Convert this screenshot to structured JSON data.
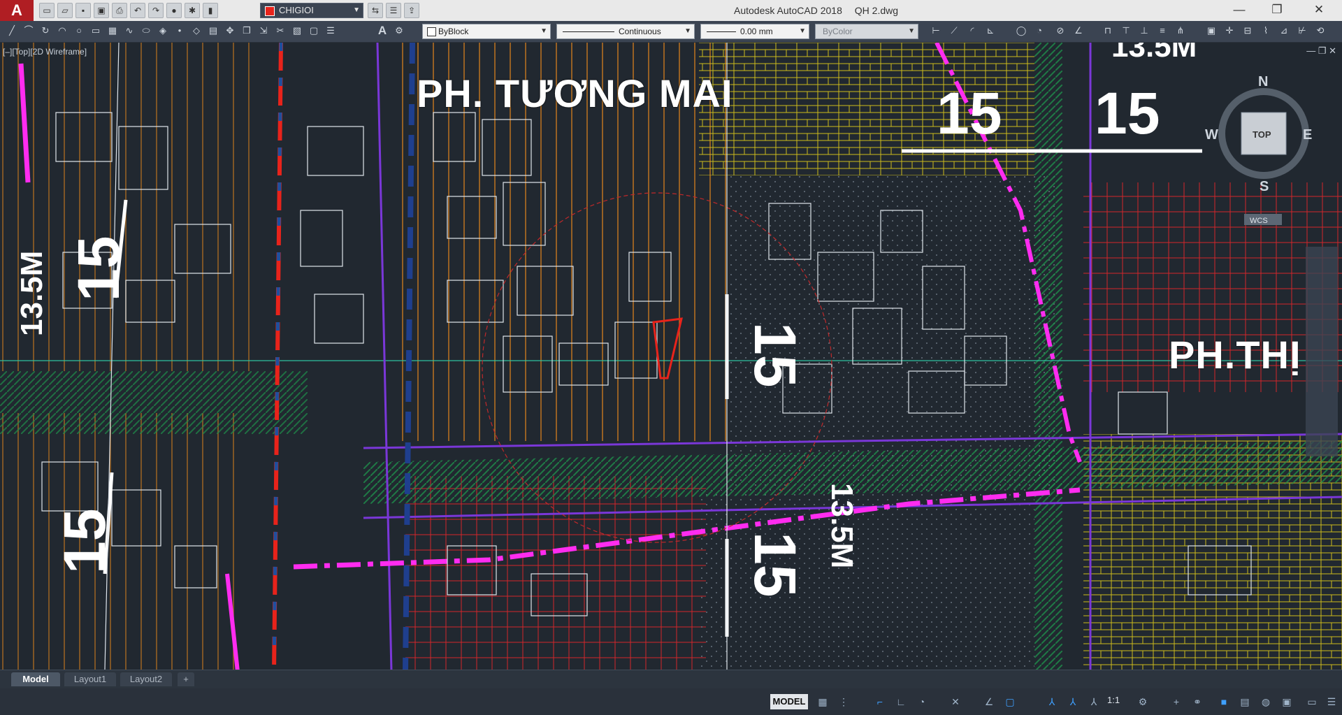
{
  "app": {
    "logo": "A",
    "window_title": "Autodesk AutoCAD 2018",
    "file_name": "QH 2.dwg",
    "window_controls": [
      "—",
      "❐",
      "✕"
    ]
  },
  "quick_access": {
    "layer_current": "CHIGIOI",
    "icons": [
      "new-icon",
      "open-icon",
      "save-icon",
      "saveas-icon",
      "plot-icon",
      "undo-icon",
      "redo-icon"
    ]
  },
  "properties": {
    "color": "ByBlock",
    "linetype": "Continuous",
    "lineweight": "0.00 mm",
    "plotstyle": "ByColor"
  },
  "viewport": {
    "label": "[–][Top][2D Wireframe]",
    "controls": "— ❐ ✕"
  },
  "drawing_labels": {
    "ward_1": "PH. TƯƠNG MAI",
    "ward_2": "PH.THỊ",
    "road_widths": [
      "15",
      "15",
      "15",
      "15",
      "15",
      "15"
    ],
    "road_lengths": [
      "13.5M",
      "13.5M",
      "13.5M"
    ]
  },
  "viewcube": {
    "top": "TOP",
    "n": "N",
    "s": "S",
    "e": "E",
    "w": "W",
    "wcs": "WCS"
  },
  "layout_tabs": [
    {
      "label": "Model",
      "active": true
    },
    {
      "label": "Layout1",
      "active": false
    },
    {
      "label": "Layout2",
      "active": false
    },
    {
      "label": "+",
      "active": false
    }
  ],
  "statusbar": {
    "mode": "MODEL",
    "scale": "1:1"
  },
  "colors": {
    "background": "#212830",
    "road_red": "#e8231b",
    "boundary_magenta": "#ff2cf0",
    "green_belt": "#1e8f4a",
    "parcel_orange": "#c8781e",
    "parcel_yellow": "#d4c020",
    "text_white": "#ffffff"
  }
}
